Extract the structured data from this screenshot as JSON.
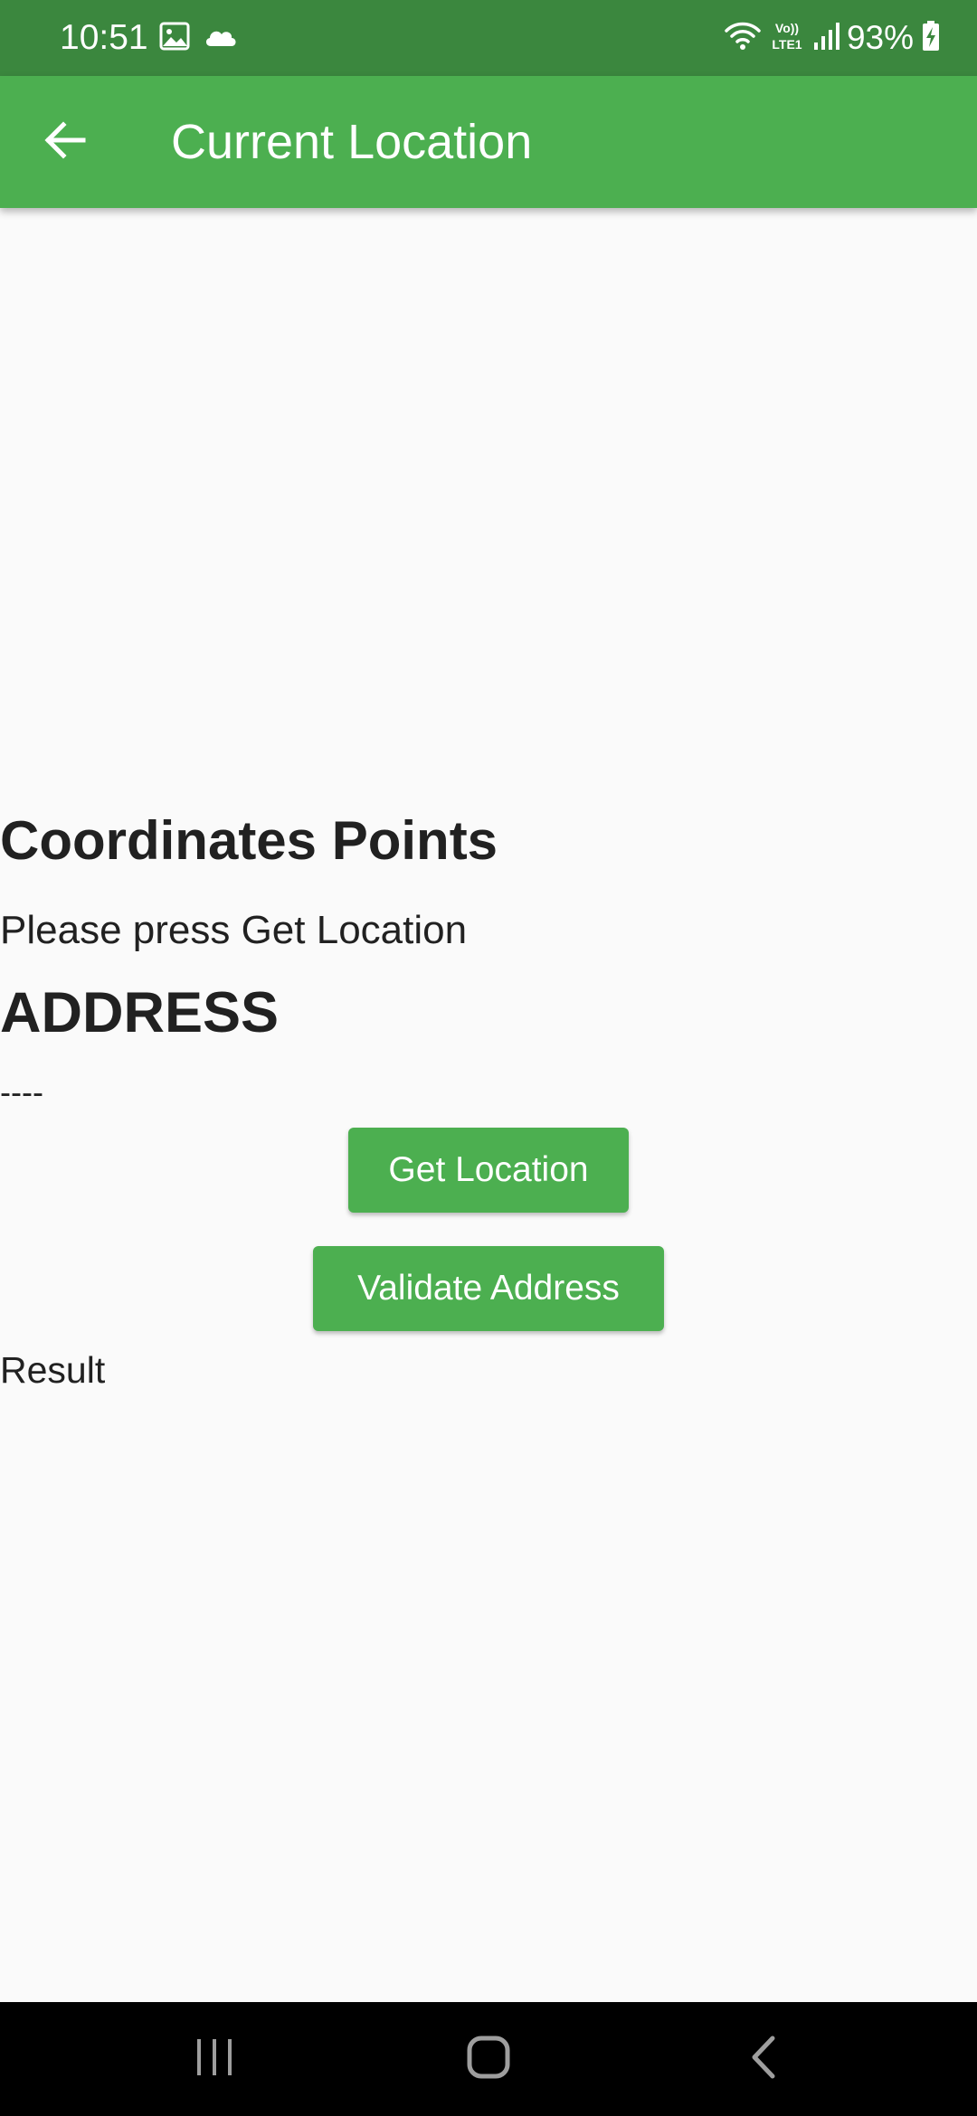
{
  "status_bar": {
    "time": "10:51",
    "battery": "93%",
    "left_icons": [
      "image-icon",
      "cloud-icon"
    ],
    "right_icons": [
      "wifi-icon",
      "volte-icon",
      "signal-icon",
      "battery-charging-icon"
    ],
    "volte_label": "Vo)) LTE1"
  },
  "app_bar": {
    "title": "Current Location",
    "back_icon": "arrow-back-icon"
  },
  "main": {
    "coordinates_heading": "Coordinates Points",
    "coordinates_value": "Please press Get Location",
    "address_heading": "ADDRESS",
    "address_value": "----",
    "get_location_label": "Get Location",
    "validate_address_label": "Validate Address",
    "result_label": "Result"
  },
  "nav_bar": {
    "buttons": [
      "recents-icon",
      "home-icon",
      "back-icon"
    ]
  },
  "colors": {
    "status_bar": "#3b873e",
    "primary": "#4caf50",
    "background": "#fafafa",
    "text": "#212121",
    "nav_bar": "#000000"
  }
}
